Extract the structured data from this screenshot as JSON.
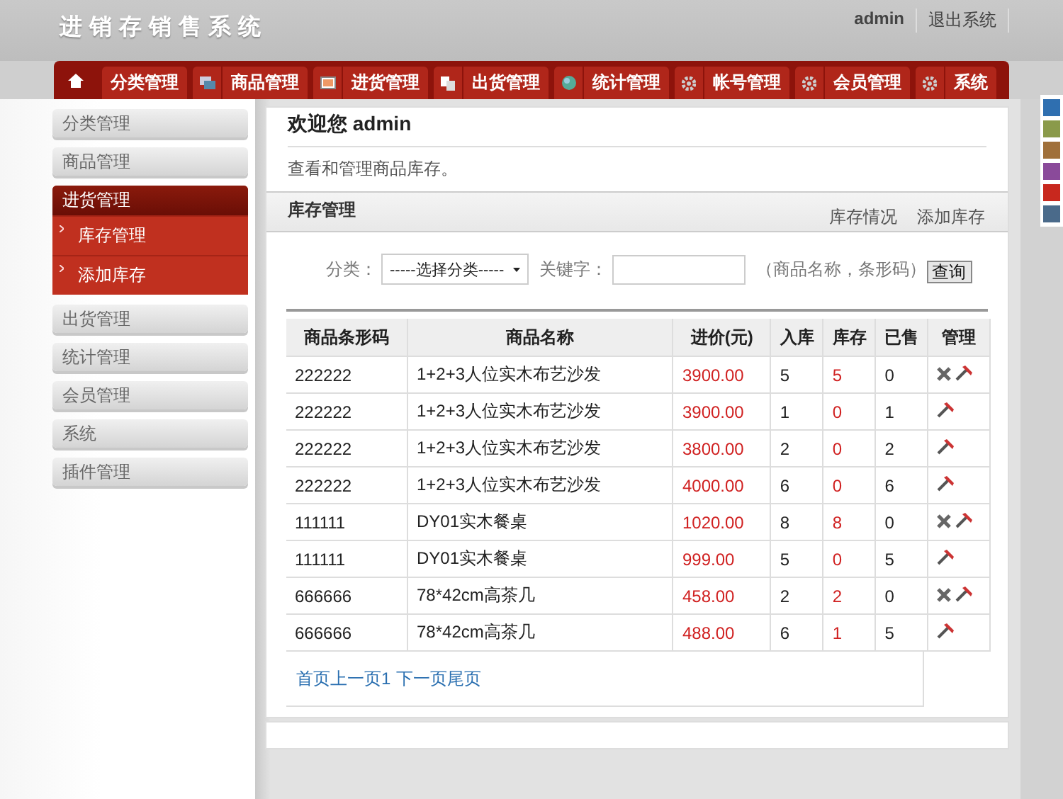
{
  "header": {
    "title": "进销存销售系统",
    "user": "admin",
    "logout": "退出系统"
  },
  "tabs": [
    {
      "label": "分类管理",
      "selected": false
    },
    {
      "label": "商品管理",
      "selected": false
    },
    {
      "label": "进货管理",
      "selected": false
    },
    {
      "label": "出货管理",
      "selected": false
    },
    {
      "label": "统计管理",
      "selected": false
    },
    {
      "label": "帐号管理",
      "selected": false
    },
    {
      "label": "会员管理",
      "selected": false
    },
    {
      "label": "系统",
      "selected": false
    }
  ],
  "sidebar": {
    "items": [
      {
        "label": "分类管理",
        "expanded": false
      },
      {
        "label": "商品管理",
        "expanded": false
      },
      {
        "label": "进货管理",
        "expanded": true,
        "children": [
          {
            "label": "库存管理"
          },
          {
            "label": "添加库存"
          }
        ]
      },
      {
        "label": "出货管理",
        "expanded": false
      },
      {
        "label": "统计管理",
        "expanded": false
      },
      {
        "label": "会员管理",
        "expanded": false
      },
      {
        "label": "系统",
        "expanded": false
      },
      {
        "label": "插件管理",
        "expanded": false
      }
    ]
  },
  "welcome": {
    "text": "欢迎您 admin",
    "description": "查看和管理商品库存。"
  },
  "section": {
    "title": "库存管理",
    "links": [
      "库存情况",
      "添加库存"
    ]
  },
  "filter": {
    "category_label": "分类：",
    "category_value": "-----选择分类-----",
    "keyword_label": "关键字：",
    "hint": "（商品名称，条形码）",
    "button": "查询"
  },
  "table": {
    "columns": [
      "商品条形码",
      "商品名称",
      "进价(元)",
      "入库",
      "库存",
      "已售",
      "管理"
    ],
    "rows": [
      {
        "barcode": "222222",
        "name": "1+2+3人位实木布艺沙发",
        "price": "3900.00",
        "in": "5",
        "stock": "5",
        "sold": "0",
        "deletable": true
      },
      {
        "barcode": "222222",
        "name": "1+2+3人位实木布艺沙发",
        "price": "3900.00",
        "in": "1",
        "stock": "0",
        "sold": "1",
        "deletable": false
      },
      {
        "barcode": "222222",
        "name": "1+2+3人位实木布艺沙发",
        "price": "3800.00",
        "in": "2",
        "stock": "0",
        "sold": "2",
        "deletable": false
      },
      {
        "barcode": "222222",
        "name": "1+2+3人位实木布艺沙发",
        "price": "4000.00",
        "in": "6",
        "stock": "0",
        "sold": "6",
        "deletable": false
      },
      {
        "barcode": "111111",
        "name": "DY01实木餐桌",
        "price": "1020.00",
        "in": "8",
        "stock": "8",
        "sold": "0",
        "deletable": true
      },
      {
        "barcode": "111111",
        "name": "DY01实木餐桌",
        "price": "999.00",
        "in": "5",
        "stock": "0",
        "sold": "5",
        "deletable": false
      },
      {
        "barcode": "666666",
        "name": "78*42cm高茶几",
        "price": "458.00",
        "in": "2",
        "stock": "2",
        "sold": "0",
        "deletable": true
      },
      {
        "barcode": "666666",
        "name": "78*42cm高茶几",
        "price": "488.00",
        "in": "6",
        "stock": "1",
        "sold": "5",
        "deletable": false
      }
    ]
  },
  "pager": [
    "首页",
    "上一页",
    "1",
    "下一页",
    "尾页"
  ],
  "theme_swatches": [
    {
      "color": "#2f6fb0"
    },
    {
      "color": "#8a9a4a"
    },
    {
      "color": "#a0703a"
    },
    {
      "color": "#8a4a9a"
    },
    {
      "color": "#c8281e"
    },
    {
      "color": "#4a6a8a"
    }
  ]
}
